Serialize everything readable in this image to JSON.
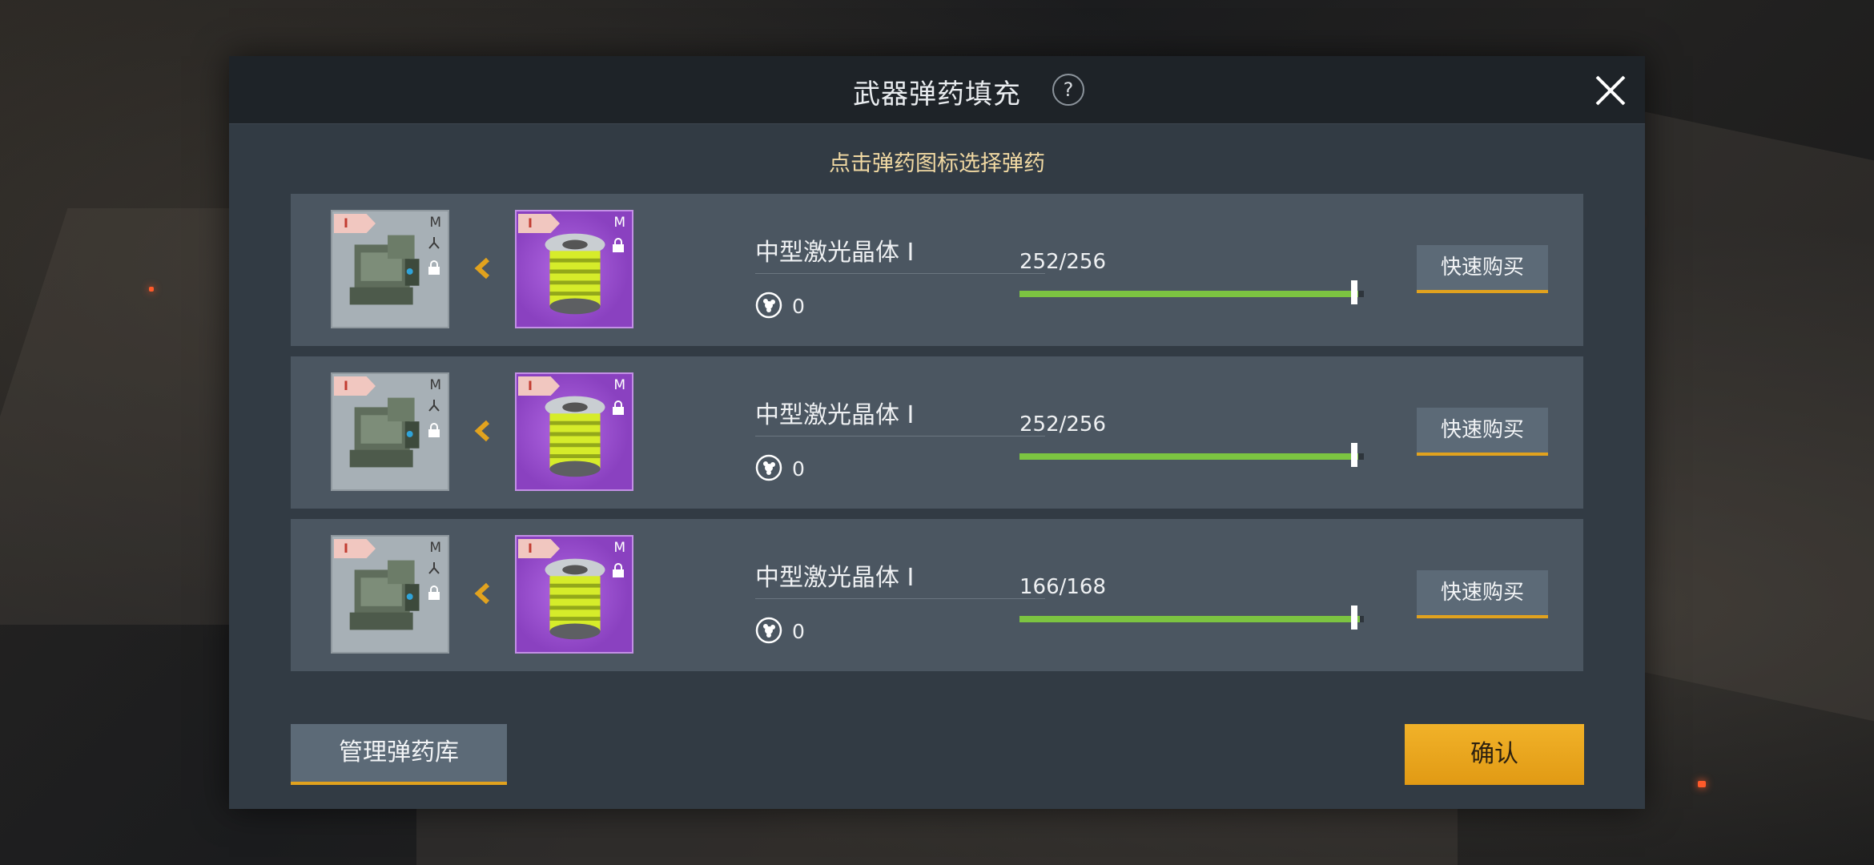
{
  "dialog": {
    "title": "武器弹药填充",
    "help_glyph": "?",
    "hint": "点击弹药图标选择弹药"
  },
  "rows": [
    {
      "weapon": {
        "tier": "I",
        "size": "M"
      },
      "ammo": {
        "tier": "I",
        "size": "M"
      },
      "name": "中型激光晶体 I",
      "coin_count": "0",
      "quantity": "252/256",
      "fill_fraction": 0.984,
      "buy_label": "快速购买"
    },
    {
      "weapon": {
        "tier": "I",
        "size": "M"
      },
      "ammo": {
        "tier": "I",
        "size": "M"
      },
      "name": "中型激光晶体 I",
      "coin_count": "0",
      "quantity": "252/256",
      "fill_fraction": 0.984,
      "buy_label": "快速购买"
    },
    {
      "weapon": {
        "tier": "I",
        "size": "M"
      },
      "ammo": {
        "tier": "I",
        "size": "M"
      },
      "name": "中型激光晶体 I",
      "coin_count": "0",
      "quantity": "166/168",
      "fill_fraction": 0.988,
      "buy_label": "快速购买"
    }
  ],
  "footer": {
    "manage_label": "管理弹药库",
    "confirm_label": "确认"
  },
  "colors": {
    "accent": "#e1a21e",
    "bar_green": "#7cc441",
    "confirm": "#f1b229",
    "ammo_bg": "#8a41c0"
  }
}
